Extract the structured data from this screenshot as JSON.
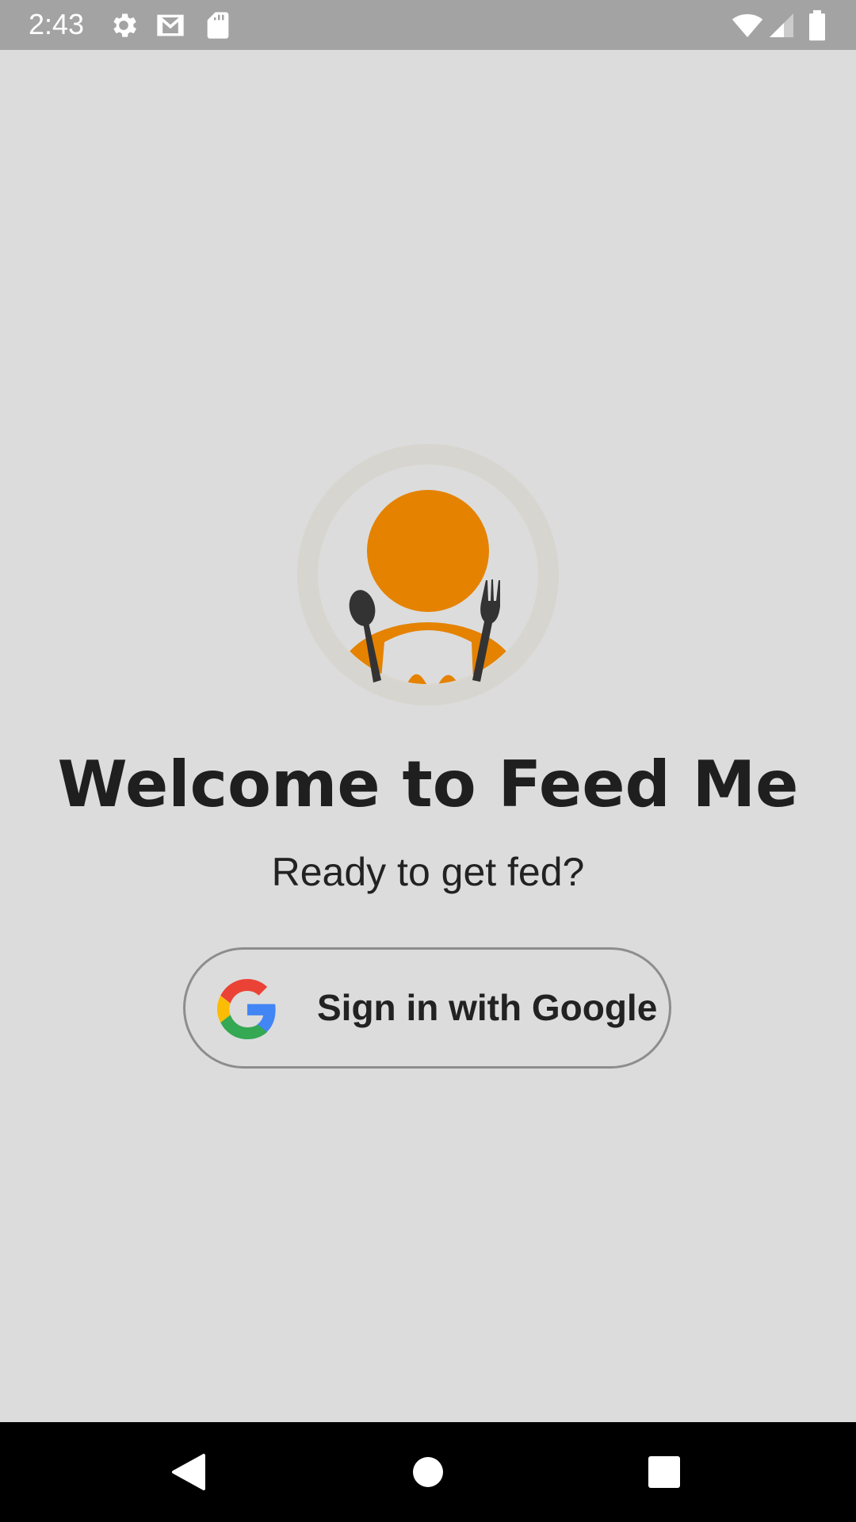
{
  "status_bar": {
    "time": "2:43",
    "icons": [
      "settings-icon",
      "gmail-icon",
      "sd-card-icon",
      "wifi-icon",
      "cell-signal-icon",
      "battery-icon"
    ]
  },
  "main": {
    "logo": "feed-me-logo",
    "title": "Welcome to Feed Me",
    "subtitle": "Ready to get fed?",
    "sign_in_button": {
      "label": "Sign in with Google",
      "icon": "google-icon"
    }
  },
  "nav_bar": {
    "buttons": [
      "back-icon",
      "home-icon",
      "recents-icon"
    ]
  },
  "colors": {
    "background": "#dcdcdc",
    "status_bar": "#a3a3a3",
    "accent_orange": "#e58200",
    "text_dark": "#1f1f1f"
  }
}
